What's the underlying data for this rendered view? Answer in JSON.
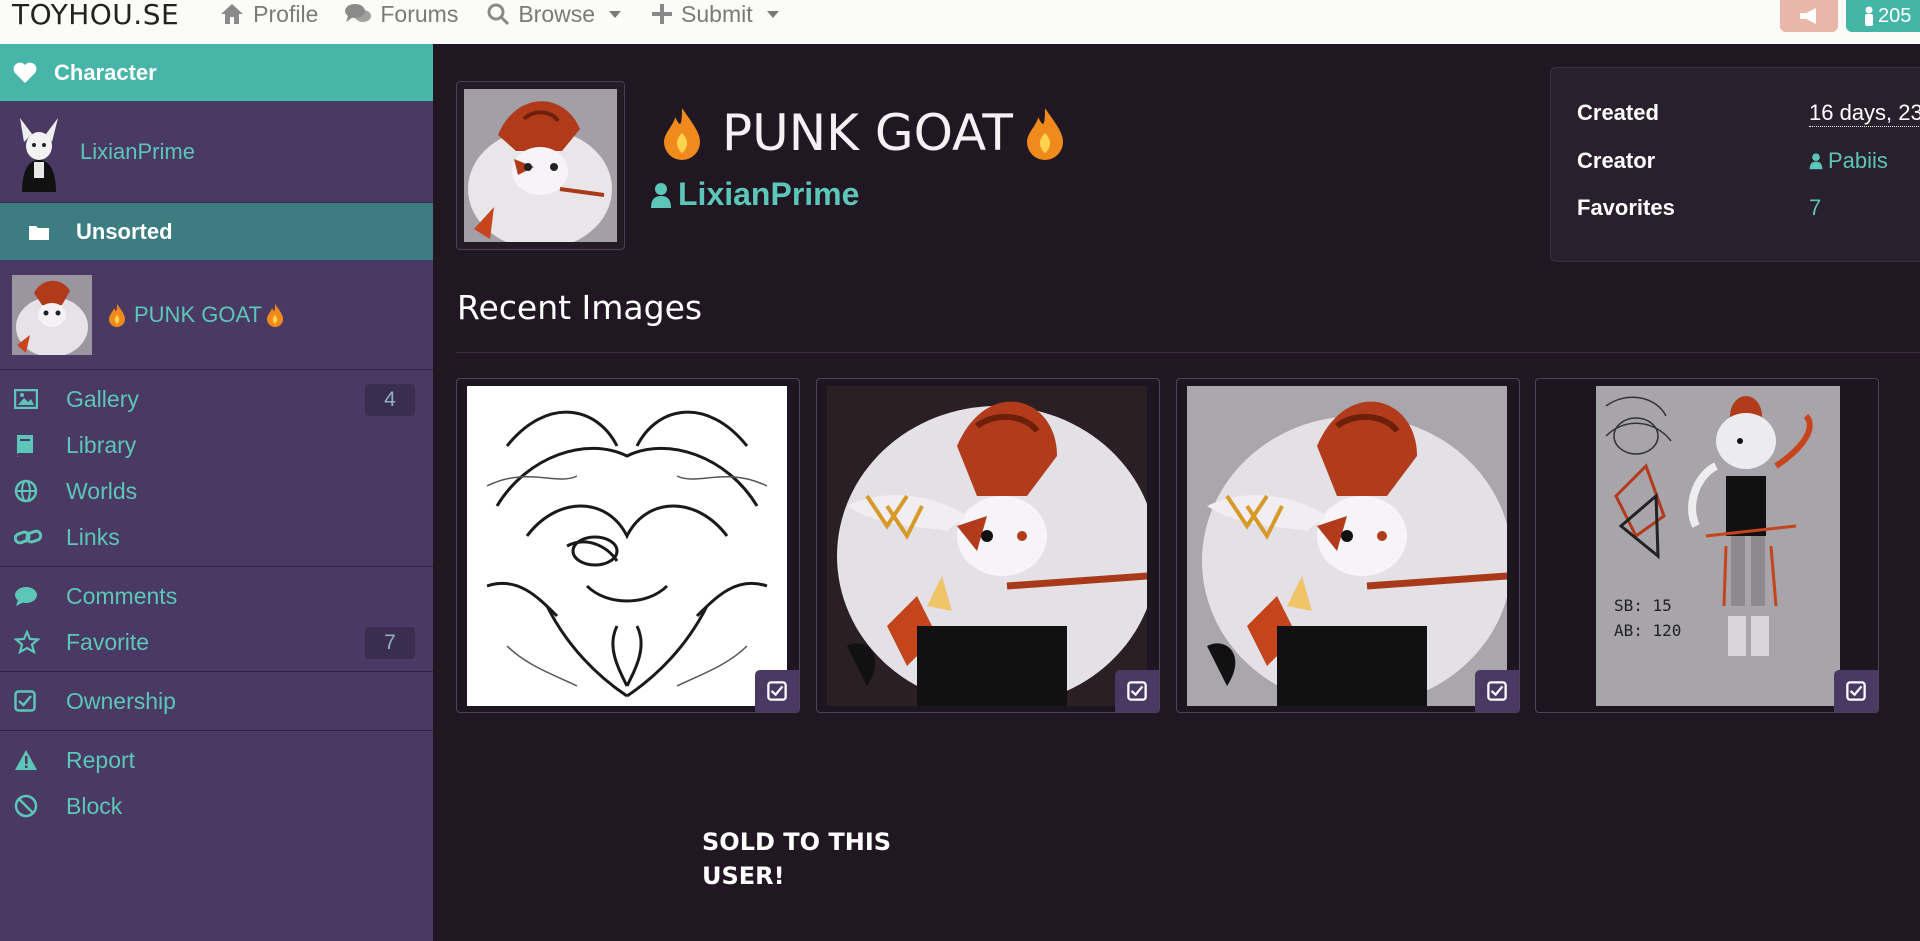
{
  "nav": {
    "brand": "TOYHOU.SE",
    "profile": "Profile",
    "forums": "Forums",
    "browse": "Browse",
    "submit": "Submit",
    "count": "205"
  },
  "sidebar": {
    "header": "Character",
    "user": "LixianPrime",
    "folder": "Unsorted",
    "character_name": "PUNK GOAT",
    "items": [
      {
        "label": "Gallery",
        "badge": "4"
      },
      {
        "label": "Library"
      },
      {
        "label": "Worlds"
      },
      {
        "label": "Links"
      },
      {
        "label": "Comments"
      },
      {
        "label": "Favorite",
        "badge": "7"
      },
      {
        "label": "Ownership"
      },
      {
        "label": "Report"
      },
      {
        "label": "Block"
      }
    ]
  },
  "character": {
    "name": "PUNK GOAT",
    "owner": "LixianPrime"
  },
  "info": {
    "created_label": "Created",
    "created_value": "16 days, 23",
    "creator_label": "Creator",
    "creator_value": "Pabiis",
    "favorites_label": "Favorites",
    "favorites_value": "7"
  },
  "recent_images": {
    "title": "Recent Images"
  },
  "note": {
    "sold": "SOLD TO THIS USER!"
  },
  "colors": {
    "accent": "#47b5a8",
    "sidebar": "#4a3a63",
    "background": "#201722"
  }
}
